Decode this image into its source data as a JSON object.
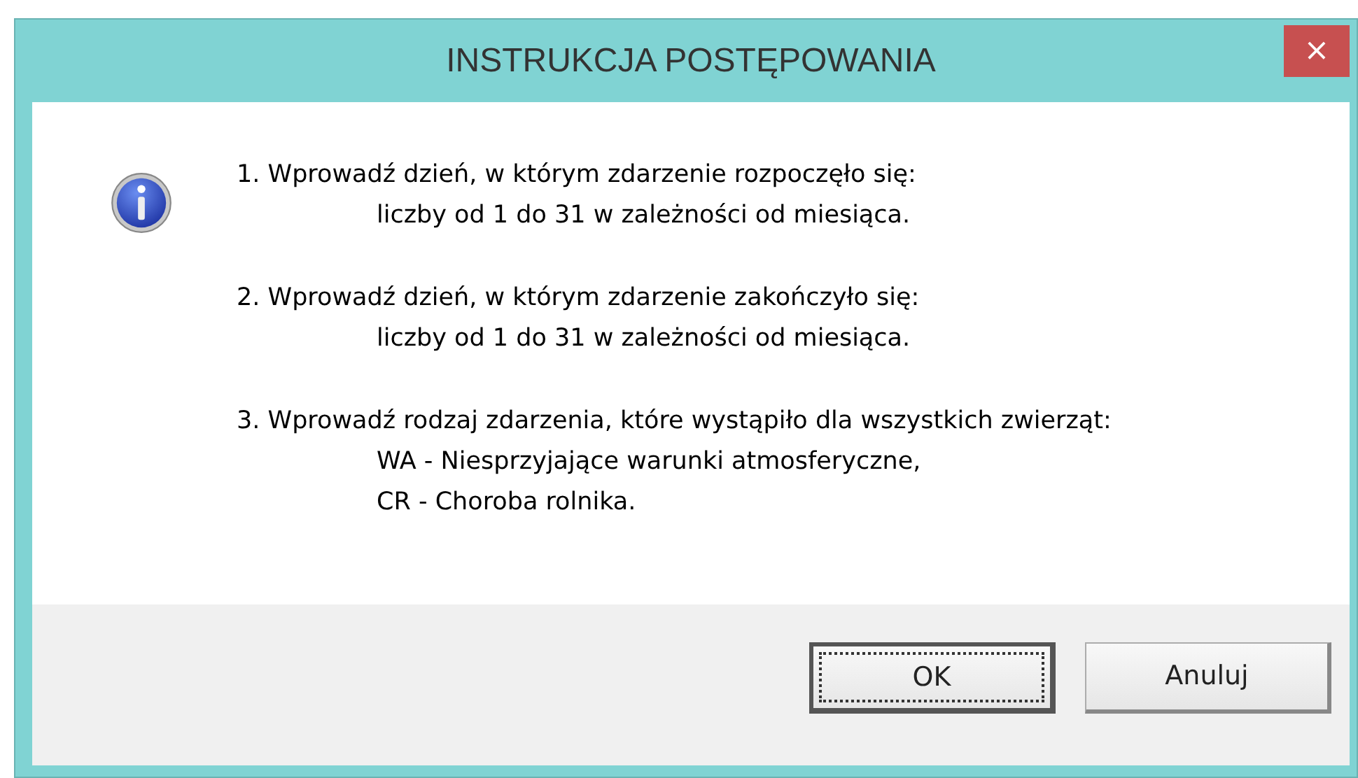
{
  "window": {
    "title": "INSTRUKCJA POSTĘPOWANIA",
    "close": "×"
  },
  "instructions": [
    {
      "text": "1. Wprowadź dzień, w którym zdarzenie rozpoczęło się:",
      "details": [
        "liczby od 1 do 31 w zależności od miesiąca."
      ]
    },
    {
      "text": "2. Wprowadź dzień, w którym zdarzenie zakończyło się:",
      "details": [
        "liczby od 1 do 31 w zależności od miesiąca."
      ]
    },
    {
      "text": "3. Wprowadź rodzaj zdarzenia, które wystąpiło dla wszystkich zwierząt:",
      "details": [
        "WA - Niesprzyjające warunki atmosferyczne,",
        "CR - Choroba rolnika."
      ]
    }
  ],
  "buttons": [
    {
      "label": "OK",
      "default": true
    },
    {
      "label": "Anuluj",
      "default": false
    }
  ]
}
